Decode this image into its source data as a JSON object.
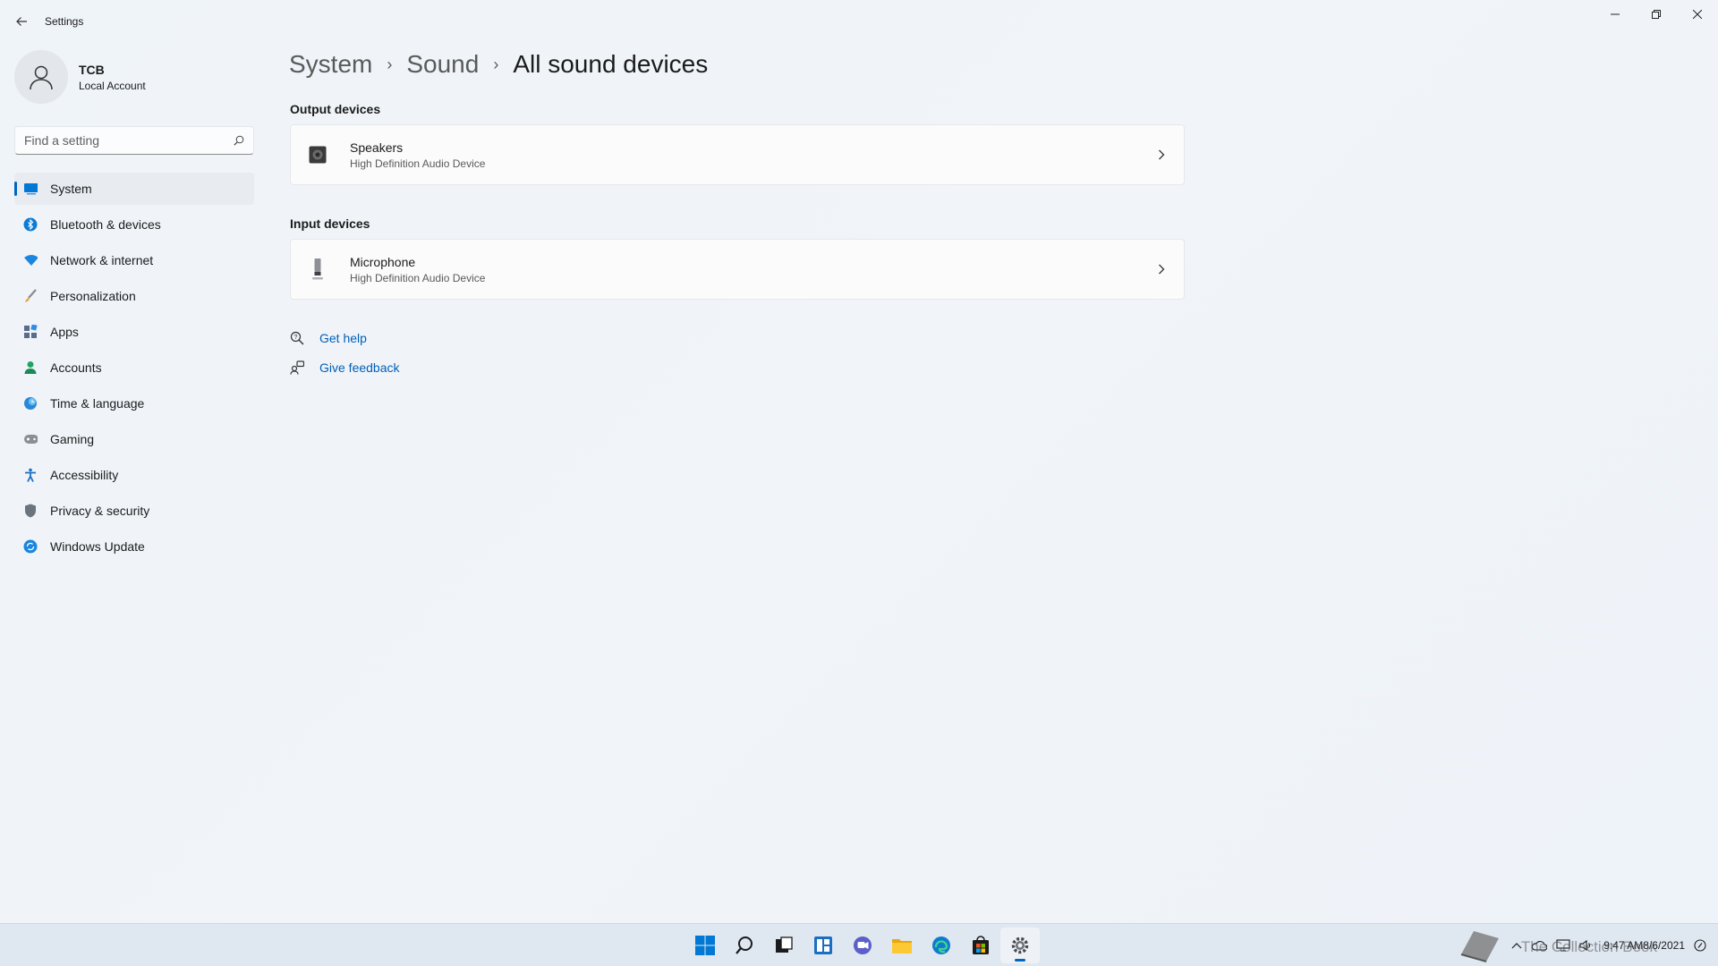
{
  "window": {
    "title": "Settings"
  },
  "profile": {
    "name": "TCB",
    "account_type": "Local Account"
  },
  "search": {
    "placeholder": "Find a setting"
  },
  "sidebar": {
    "items": [
      {
        "label": "System",
        "icon": "system-icon"
      },
      {
        "label": "Bluetooth & devices",
        "icon": "bluetooth-icon"
      },
      {
        "label": "Network & internet",
        "icon": "network-icon"
      },
      {
        "label": "Personalization",
        "icon": "brush-icon"
      },
      {
        "label": "Apps",
        "icon": "apps-icon"
      },
      {
        "label": "Accounts",
        "icon": "accounts-icon"
      },
      {
        "label": "Time & language",
        "icon": "time-language-icon"
      },
      {
        "label": "Gaming",
        "icon": "gaming-icon"
      },
      {
        "label": "Accessibility",
        "icon": "accessibility-icon"
      },
      {
        "label": "Privacy & security",
        "icon": "shield-icon"
      },
      {
        "label": "Windows Update",
        "icon": "update-icon"
      }
    ],
    "active_index": 0
  },
  "breadcrumb": {
    "items": [
      "System",
      "Sound",
      "All sound devices"
    ]
  },
  "output": {
    "title": "Output devices",
    "devices": [
      {
        "name": "Speakers",
        "description": "High Definition Audio Device",
        "icon": "speaker-icon"
      }
    ]
  },
  "input": {
    "title": "Input devices",
    "devices": [
      {
        "name": "Microphone",
        "description": "High Definition Audio Device",
        "icon": "microphone-icon"
      }
    ]
  },
  "links": {
    "help": "Get help",
    "feedback": "Give feedback"
  },
  "taskbar": {
    "apps": [
      "start-icon",
      "search-icon",
      "task-view-icon",
      "widgets-icon",
      "chat-icon",
      "file-explorer-icon",
      "edge-icon",
      "store-icon",
      "settings-icon"
    ],
    "active_app": "settings-icon",
    "time": "9:47 AM",
    "date": "8/6/2021",
    "watermark": "The Collection Book"
  },
  "colors": {
    "accent": "#0067c0",
    "link": "#005fb8"
  }
}
